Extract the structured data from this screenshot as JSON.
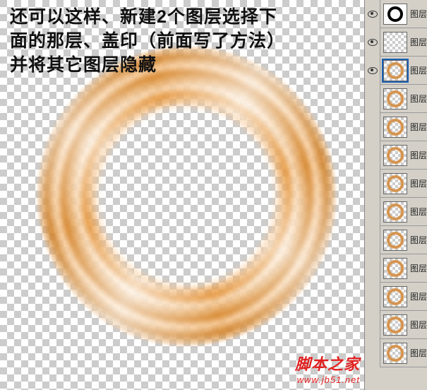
{
  "overlay": {
    "line1": "还可以这样、新建2个图层选择下",
    "line2": "面的那层、盖印（前面写了方法）",
    "line3": "并将其它图层隐藏"
  },
  "layers": [
    {
      "visible": true,
      "selected": false,
      "thumb": "black-ring",
      "name": "图层"
    },
    {
      "visible": true,
      "selected": false,
      "thumb": "blank",
      "name": "图层"
    },
    {
      "visible": true,
      "selected": true,
      "thumb": "ring",
      "name": "图层"
    },
    {
      "visible": false,
      "selected": false,
      "thumb": "ring",
      "name": "图层"
    },
    {
      "visible": false,
      "selected": false,
      "thumb": "ring",
      "name": "图层"
    },
    {
      "visible": false,
      "selected": false,
      "thumb": "ring",
      "name": "图层"
    },
    {
      "visible": false,
      "selected": false,
      "thumb": "ring",
      "name": "图层"
    },
    {
      "visible": false,
      "selected": false,
      "thumb": "ring",
      "name": "图层"
    },
    {
      "visible": false,
      "selected": false,
      "thumb": "ring",
      "name": "图层"
    },
    {
      "visible": false,
      "selected": false,
      "thumb": "ring",
      "name": "图层"
    },
    {
      "visible": false,
      "selected": false,
      "thumb": "ring",
      "name": "图层"
    },
    {
      "visible": false,
      "selected": false,
      "thumb": "ring",
      "name": "图层"
    },
    {
      "visible": false,
      "selected": false,
      "thumb": "ring",
      "name": "图层"
    }
  ],
  "watermark": {
    "title": "脚本之家",
    "url": "www.jb51.net"
  }
}
